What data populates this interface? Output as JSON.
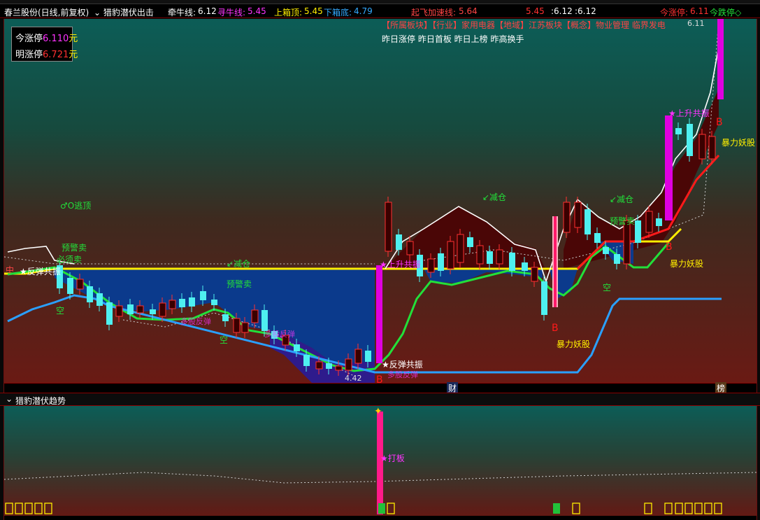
{
  "infobar": {
    "stock": "春兰股份(日线,前复权)",
    "indicator": "猎豹潜伏出击",
    "qianniu_label": "牵牛线:",
    "qianniu_value": "6.12",
    "xunniu_label": "寻牛线:",
    "xunniu_value": "5.45",
    "shangxiang_label": "上箱顶:",
    "shangxiang_value": "5.45",
    "xiaxiang_label": "下箱底:",
    "xiaxiang_value": "4.79",
    "qifei_label": "起飞加速线:",
    "qifei_value": "5.64",
    "v1": "5.45",
    "v2": ":6.12",
    "v3": ":6.12",
    "jzt_label": "今涨停:",
    "jzt_value": "6.11",
    "jdt_label": "今跌停◇"
  },
  "limit_box": {
    "today_label": "今涨停",
    "today_value": "6.110",
    "today_unit": "元",
    "tomorrow_label": "明涨停",
    "tomorrow_value": "6.721",
    "tomorrow_unit": "元"
  },
  "sector": {
    "line1": "【所属板块】【行业】家用电器【地域】江苏板块【概念】物业管理 临界发电",
    "line2": "昨日涨停 昨日首板 昨日上榜 昨高换手"
  },
  "chart_labels": {
    "peak_price": "6.11",
    "low_price": "4.42",
    "escape": "♂O逃顶",
    "warn_sell_1": "预警卖",
    "must_sell": "必须卖",
    "rebound_1": "★反弹共振",
    "reduce_1": "↙减仓",
    "warn_sell_2": "预警卖",
    "rebound_2": "★反弹共振",
    "rise_1": "★上升共振",
    "reduce_2": "↙减仓",
    "reduce_3": "↙减仓",
    "warn_sell_3": "预警卖",
    "rise_2": "★上升共振",
    "monster_1": "暴力妖股",
    "monster_2": "暴力妖股",
    "monster_3": "暴力妖股",
    "b1": "B",
    "b2": "B",
    "b3": "B",
    "b4": "B",
    "kong1": "空",
    "kong2": "空",
    "kong3": "空",
    "zhong": "中",
    "cai": "财",
    "bang": "榜",
    "tangle_1": "多股反弹",
    "tangle_2": "多股反弹",
    "tangle_3": "多股反弹"
  },
  "subpanel": {
    "title": "猎豹潜伏趋势",
    "attack": "★打板"
  },
  "colors": {
    "bull": "#ff3030",
    "bear": "#4ef0f0",
    "white_line": "#ffffff",
    "yellow_line": "#ffee00",
    "green_line": "#22e03a",
    "red_line": "#ff1a1a",
    "blue_line": "#2aa0ff",
    "magenta": "#e000e0",
    "fill_blue": "#0b3a8c",
    "fill_purple": "#2e1b8c",
    "fill_darkred": "#5a0a0a"
  }
}
